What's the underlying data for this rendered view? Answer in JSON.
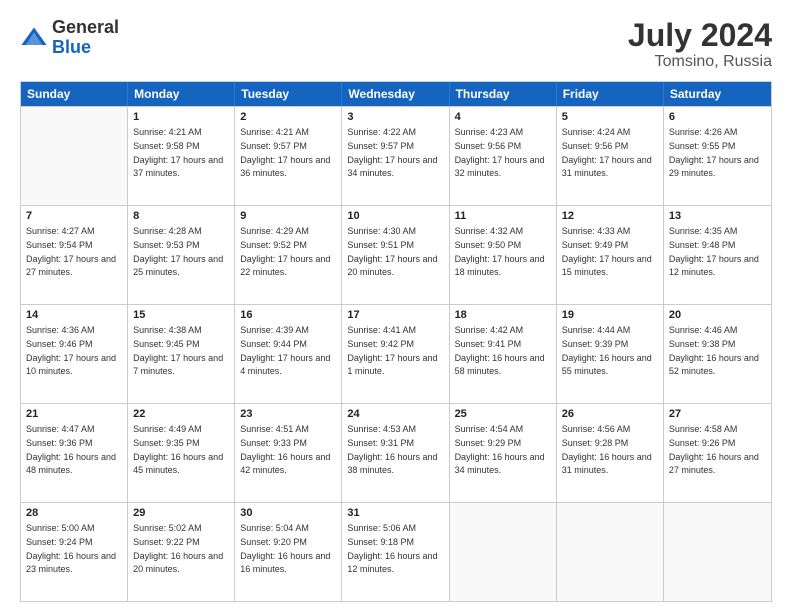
{
  "header": {
    "logo_general": "General",
    "logo_blue": "Blue",
    "month_year": "July 2024",
    "location": "Tomsino, Russia"
  },
  "days_of_week": [
    "Sunday",
    "Monday",
    "Tuesday",
    "Wednesday",
    "Thursday",
    "Friday",
    "Saturday"
  ],
  "weeks": [
    [
      {
        "day": "",
        "sunrise": "",
        "sunset": "",
        "daylight": ""
      },
      {
        "day": "1",
        "sunrise": "Sunrise: 4:21 AM",
        "sunset": "Sunset: 9:58 PM",
        "daylight": "Daylight: 17 hours and 37 minutes."
      },
      {
        "day": "2",
        "sunrise": "Sunrise: 4:21 AM",
        "sunset": "Sunset: 9:57 PM",
        "daylight": "Daylight: 17 hours and 36 minutes."
      },
      {
        "day": "3",
        "sunrise": "Sunrise: 4:22 AM",
        "sunset": "Sunset: 9:57 PM",
        "daylight": "Daylight: 17 hours and 34 minutes."
      },
      {
        "day": "4",
        "sunrise": "Sunrise: 4:23 AM",
        "sunset": "Sunset: 9:56 PM",
        "daylight": "Daylight: 17 hours and 32 minutes."
      },
      {
        "day": "5",
        "sunrise": "Sunrise: 4:24 AM",
        "sunset": "Sunset: 9:56 PM",
        "daylight": "Daylight: 17 hours and 31 minutes."
      },
      {
        "day": "6",
        "sunrise": "Sunrise: 4:26 AM",
        "sunset": "Sunset: 9:55 PM",
        "daylight": "Daylight: 17 hours and 29 minutes."
      }
    ],
    [
      {
        "day": "7",
        "sunrise": "Sunrise: 4:27 AM",
        "sunset": "Sunset: 9:54 PM",
        "daylight": "Daylight: 17 hours and 27 minutes."
      },
      {
        "day": "8",
        "sunrise": "Sunrise: 4:28 AM",
        "sunset": "Sunset: 9:53 PM",
        "daylight": "Daylight: 17 hours and 25 minutes."
      },
      {
        "day": "9",
        "sunrise": "Sunrise: 4:29 AM",
        "sunset": "Sunset: 9:52 PM",
        "daylight": "Daylight: 17 hours and 22 minutes."
      },
      {
        "day": "10",
        "sunrise": "Sunrise: 4:30 AM",
        "sunset": "Sunset: 9:51 PM",
        "daylight": "Daylight: 17 hours and 20 minutes."
      },
      {
        "day": "11",
        "sunrise": "Sunrise: 4:32 AM",
        "sunset": "Sunset: 9:50 PM",
        "daylight": "Daylight: 17 hours and 18 minutes."
      },
      {
        "day": "12",
        "sunrise": "Sunrise: 4:33 AM",
        "sunset": "Sunset: 9:49 PM",
        "daylight": "Daylight: 17 hours and 15 minutes."
      },
      {
        "day": "13",
        "sunrise": "Sunrise: 4:35 AM",
        "sunset": "Sunset: 9:48 PM",
        "daylight": "Daylight: 17 hours and 12 minutes."
      }
    ],
    [
      {
        "day": "14",
        "sunrise": "Sunrise: 4:36 AM",
        "sunset": "Sunset: 9:46 PM",
        "daylight": "Daylight: 17 hours and 10 minutes."
      },
      {
        "day": "15",
        "sunrise": "Sunrise: 4:38 AM",
        "sunset": "Sunset: 9:45 PM",
        "daylight": "Daylight: 17 hours and 7 minutes."
      },
      {
        "day": "16",
        "sunrise": "Sunrise: 4:39 AM",
        "sunset": "Sunset: 9:44 PM",
        "daylight": "Daylight: 17 hours and 4 minutes."
      },
      {
        "day": "17",
        "sunrise": "Sunrise: 4:41 AM",
        "sunset": "Sunset: 9:42 PM",
        "daylight": "Daylight: 17 hours and 1 minute."
      },
      {
        "day": "18",
        "sunrise": "Sunrise: 4:42 AM",
        "sunset": "Sunset: 9:41 PM",
        "daylight": "Daylight: 16 hours and 58 minutes."
      },
      {
        "day": "19",
        "sunrise": "Sunrise: 4:44 AM",
        "sunset": "Sunset: 9:39 PM",
        "daylight": "Daylight: 16 hours and 55 minutes."
      },
      {
        "day": "20",
        "sunrise": "Sunrise: 4:46 AM",
        "sunset": "Sunset: 9:38 PM",
        "daylight": "Daylight: 16 hours and 52 minutes."
      }
    ],
    [
      {
        "day": "21",
        "sunrise": "Sunrise: 4:47 AM",
        "sunset": "Sunset: 9:36 PM",
        "daylight": "Daylight: 16 hours and 48 minutes."
      },
      {
        "day": "22",
        "sunrise": "Sunrise: 4:49 AM",
        "sunset": "Sunset: 9:35 PM",
        "daylight": "Daylight: 16 hours and 45 minutes."
      },
      {
        "day": "23",
        "sunrise": "Sunrise: 4:51 AM",
        "sunset": "Sunset: 9:33 PM",
        "daylight": "Daylight: 16 hours and 42 minutes."
      },
      {
        "day": "24",
        "sunrise": "Sunrise: 4:53 AM",
        "sunset": "Sunset: 9:31 PM",
        "daylight": "Daylight: 16 hours and 38 minutes."
      },
      {
        "day": "25",
        "sunrise": "Sunrise: 4:54 AM",
        "sunset": "Sunset: 9:29 PM",
        "daylight": "Daylight: 16 hours and 34 minutes."
      },
      {
        "day": "26",
        "sunrise": "Sunrise: 4:56 AM",
        "sunset": "Sunset: 9:28 PM",
        "daylight": "Daylight: 16 hours and 31 minutes."
      },
      {
        "day": "27",
        "sunrise": "Sunrise: 4:58 AM",
        "sunset": "Sunset: 9:26 PM",
        "daylight": "Daylight: 16 hours and 27 minutes."
      }
    ],
    [
      {
        "day": "28",
        "sunrise": "Sunrise: 5:00 AM",
        "sunset": "Sunset: 9:24 PM",
        "daylight": "Daylight: 16 hours and 23 minutes."
      },
      {
        "day": "29",
        "sunrise": "Sunrise: 5:02 AM",
        "sunset": "Sunset: 9:22 PM",
        "daylight": "Daylight: 16 hours and 20 minutes."
      },
      {
        "day": "30",
        "sunrise": "Sunrise: 5:04 AM",
        "sunset": "Sunset: 9:20 PM",
        "daylight": "Daylight: 16 hours and 16 minutes."
      },
      {
        "day": "31",
        "sunrise": "Sunrise: 5:06 AM",
        "sunset": "Sunset: 9:18 PM",
        "daylight": "Daylight: 16 hours and 12 minutes."
      },
      {
        "day": "",
        "sunrise": "",
        "sunset": "",
        "daylight": ""
      },
      {
        "day": "",
        "sunrise": "",
        "sunset": "",
        "daylight": ""
      },
      {
        "day": "",
        "sunrise": "",
        "sunset": "",
        "daylight": ""
      }
    ]
  ]
}
